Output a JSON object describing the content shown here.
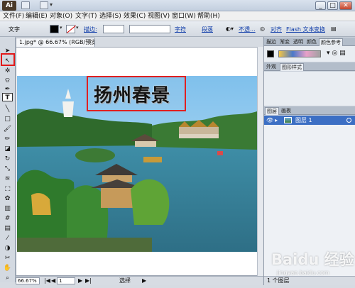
{
  "app": {
    "logo_text": "Ai",
    "buttons": {
      "minimize": "_",
      "restore": "□",
      "close": "✕"
    }
  },
  "menu": [
    {
      "label": "文件(F)"
    },
    {
      "label": "编辑(E)"
    },
    {
      "label": "对象(O)"
    },
    {
      "label": "文字(T)"
    },
    {
      "label": "选择(S)"
    },
    {
      "label": "效果(C)"
    },
    {
      "label": "视图(V)"
    },
    {
      "label": "窗口(W)"
    },
    {
      "label": "帮助(H)"
    }
  ],
  "controlbar": {
    "tool_label": "文字",
    "stroke_link": "描边:",
    "char_link": "字符",
    "para_link": "段落",
    "opacity_link": "不透...",
    "align_link": "对齐",
    "flash_link": "Flash 文本",
    "transform_link": "变换"
  },
  "document": {
    "tab_label": "1.jpg* @ 66.67% (RGB/预览)",
    "overlay_title": "扬州春景",
    "zoom": "66.67%",
    "page": "1",
    "status": "选择"
  },
  "panels": {
    "top_tabs": [
      "描边",
      "渐变",
      "透明",
      "颜色",
      "颜色参考"
    ],
    "appearance_tabs": [
      "外观",
      "图形样式"
    ],
    "layers_tabs": [
      "图层",
      "画板"
    ],
    "layer_name": "图层 1",
    "layer_count": "1 个图层",
    "swatch_colors": [
      "#000000",
      "#f5c542",
      "#4a78c9",
      "#e8a0c8",
      "#a0a0a0"
    ]
  },
  "watermark": {
    "text": "Baidu 经验",
    "url": "jingyan.baidu.com"
  },
  "tools": [
    "selection-tool",
    "direct-selection-tool",
    "magic-wand-tool",
    "lasso-tool",
    "pen-tool",
    "type-tool",
    "line-tool",
    "rectangle-tool",
    "paintbrush-tool",
    "pencil-tool",
    "blob-brush-tool",
    "eraser-tool",
    "rotate-tool",
    "scale-tool",
    "warp-tool",
    "free-transform-tool",
    "symbol-sprayer-tool",
    "column-graph-tool",
    "mesh-tool",
    "gradient-tool",
    "eyedropper-tool",
    "blend-tool",
    "live-paint-tool",
    "artboard-tool",
    "slice-tool",
    "hand-tool",
    "zoom-tool"
  ]
}
